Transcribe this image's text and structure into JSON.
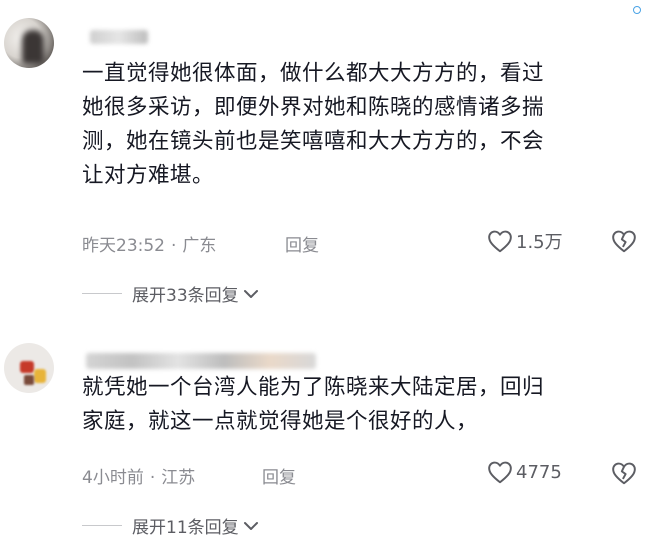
{
  "comments": [
    {
      "text_lines": [
        "一直觉得她很体面，做什么都大大方方的，看过",
        "她很多采访，即便外界对她和陈晓的感情诸多揣",
        "测，她在镜头前也是笑嘻嘻和大大方方的，不会",
        "让对方难堪。"
      ],
      "time": "昨天23:52",
      "location": "广东",
      "reply_label": "回复",
      "likes": "1.5万",
      "expand_label": "展开33条回复"
    },
    {
      "text_lines": [
        "就凭她一个台湾人能为了陈晓来大陆定居，回归",
        "家庭，就这一点就觉得她是个很好的人，"
      ],
      "time": "4小时前",
      "location": "江苏",
      "reply_label": "回复",
      "likes": "4775",
      "expand_label": "展开11条回复"
    }
  ],
  "icons": {
    "like": "heart-outline-icon",
    "dislike": "broken-heart-icon",
    "expand": "chevron-down-icon"
  },
  "colors": {
    "text": "#161823",
    "meta": "#8a8b91",
    "secondary": "#5c5d63"
  }
}
